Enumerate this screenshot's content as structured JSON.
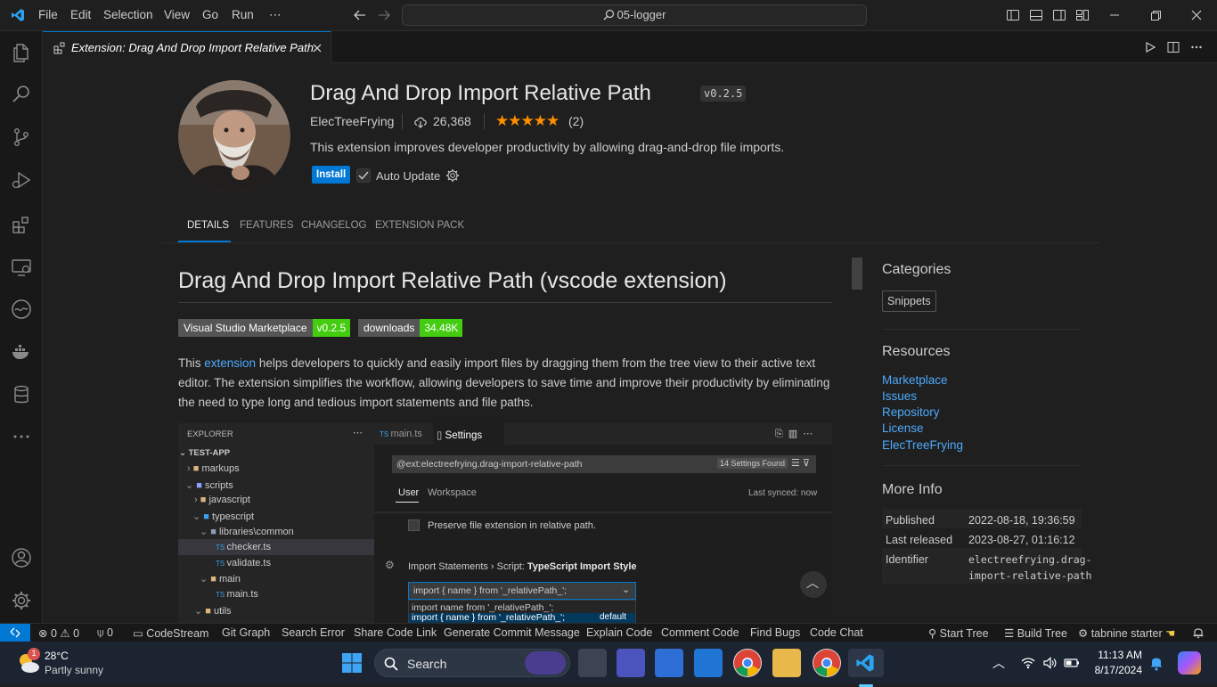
{
  "titlebar": {
    "menu": [
      "File",
      "Edit",
      "Selection",
      "View",
      "Go",
      "Run",
      "⋯"
    ],
    "search_text": "05-logger"
  },
  "tab": {
    "label": "Extension: Drag And Drop Import Relative Path"
  },
  "extension": {
    "name": "Drag And Drop Import Relative Path",
    "version": "v0.2.5",
    "publisher": "ElecTreeFrying",
    "installs": "26,368",
    "stars": "★★★★★",
    "rating_count": "(2)",
    "description": "This extension improves developer productivity by allowing drag-and-drop file imports.",
    "install_label": "Install",
    "auto_update_label": "Auto Update",
    "tabs": [
      "DETAILS",
      "FEATURES",
      "CHANGELOG",
      "EXTENSION PACK"
    ]
  },
  "readme": {
    "heading": "Drag And Drop Import Relative Path (vscode extension)",
    "badge1_left": "Visual Studio Marketplace",
    "badge1_right": "v0.2.5",
    "badge2_left": "downloads",
    "badge2_right": "34.48K",
    "para_prefix": "This ",
    "para_link": "extension",
    "para_rest": " helps developers to quickly and easily import files by dragging them from the tree view to their active text editor. The extension simplifies the workflow, allowing developers to save time and improve their productivity by eliminating the need to type long and tedious import statements and file paths."
  },
  "screenshot": {
    "explorer_title": "EXPLORER",
    "root": "TEST-APP",
    "tree": [
      "markups",
      "scripts",
      "javascript",
      "typescript",
      "libraries\\common",
      "checker.ts",
      "validate.ts",
      "main",
      "main.ts",
      "utils"
    ],
    "tab1": "main.ts",
    "tab2": "Settings",
    "search": "@ext:electreefrying.drag-import-relative-path",
    "found": "14 Settings Found",
    "scope_user": "User",
    "scope_ws": "Workspace",
    "synced": "Last synced: now",
    "checkbox_label": "Preserve file extension in relative path.",
    "setting_title_pre": "Import Statements › Script: ",
    "setting_title_bold": "TypeScript Import Style",
    "select_value": "import { name } from '_relativePath_';",
    "option1": "import name from '_relativePath_';",
    "option2": "import { name } from '_relativePath_';",
    "option2_tag": "default"
  },
  "sidebar": {
    "categories_heading": "Categories",
    "category": "Snippets",
    "resources_heading": "Resources",
    "resources": [
      "Marketplace",
      "Issues",
      "Repository",
      "License",
      "ElecTreeFrying"
    ],
    "more_info_heading": "More Info",
    "published_label": "Published",
    "published_value": "2022-08-18, 19:36:59",
    "last_released_label": "Last released",
    "last_released_value": "2023-08-27, 01:16:12",
    "identifier_label": "Identifier",
    "identifier_value_1": "electreefrying.drag-",
    "identifier_value_2": "import-relative-path"
  },
  "statusbar": {
    "errors": "0",
    "warnings": "0",
    "ports": "0",
    "items": [
      "CodeStream",
      "Git Graph",
      "Search Error",
      "Share Code Link",
      "Generate Commit Message",
      "Explain Code",
      "Comment Code",
      "Find Bugs",
      "Code Chat"
    ],
    "start_tree": "Start Tree",
    "build_tree": "Build Tree",
    "tabnine": "tabnine starter"
  },
  "taskbar": {
    "temp": "28°C",
    "weather": "Partly sunny",
    "weather_badge": "1",
    "search_label": "Search",
    "time": "11:13 AM",
    "date": "8/17/2024"
  },
  "colors": {
    "accent": "#0078d4",
    "link": "#4daafc",
    "badge_green": "#4c1",
    "star": "#ff8e00"
  }
}
